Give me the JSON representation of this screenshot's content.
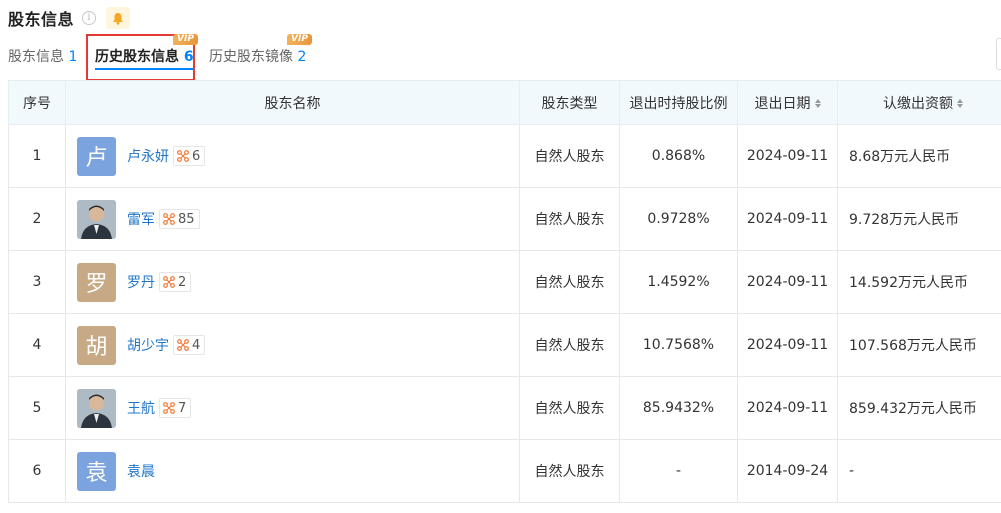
{
  "header": {
    "title": "股东信息",
    "info_icon": "info-icon",
    "bell_icon": "bell-icon",
    "bell_color": "#f5a623"
  },
  "tabs": [
    {
      "label": "股东信息",
      "count": "1",
      "active": false
    },
    {
      "label": "历史股东信息",
      "count": "6",
      "active": true,
      "vip": "VIP"
    },
    {
      "label": "历史股东镜像",
      "count": "2",
      "active": false,
      "vip": "VIP"
    }
  ],
  "table": {
    "columns": [
      "序号",
      "股东名称",
      "股东类型",
      "退出时持股比例",
      "退出日期",
      "认缴出资额"
    ],
    "rows": [
      {
        "index": "1",
        "avatar_char": "卢",
        "avatar_type": "blue",
        "name": "卢永妍",
        "rel_count": "6",
        "type": "自然人股东",
        "ratio": "0.868%",
        "date": "2024-09-11",
        "capital": "8.68万元人民币"
      },
      {
        "index": "2",
        "avatar_char": "",
        "avatar_type": "photo",
        "name": "雷军",
        "rel_count": "85",
        "type": "自然人股东",
        "ratio": "0.9728%",
        "date": "2024-09-11",
        "capital": "9.728万元人民币"
      },
      {
        "index": "3",
        "avatar_char": "罗",
        "avatar_type": "tan",
        "name": "罗丹",
        "rel_count": "2",
        "type": "自然人股东",
        "ratio": "1.4592%",
        "date": "2024-09-11",
        "capital": "14.592万元人民币"
      },
      {
        "index": "4",
        "avatar_char": "胡",
        "avatar_type": "tan",
        "name": "胡少宇",
        "rel_count": "4",
        "type": "自然人股东",
        "ratio": "10.7568%",
        "date": "2024-09-11",
        "capital": "107.568万元人民币"
      },
      {
        "index": "5",
        "avatar_char": "",
        "avatar_type": "photo",
        "name": "王航",
        "rel_count": "7",
        "type": "自然人股东",
        "ratio": "85.9432%",
        "date": "2024-09-11",
        "capital": "859.432万元人民币"
      },
      {
        "index": "6",
        "avatar_char": "袁",
        "avatar_type": "blue",
        "name": "袁晨",
        "rel_count": "",
        "type": "自然人股东",
        "ratio": "-",
        "date": "2014-09-24",
        "capital": "-"
      }
    ]
  },
  "colors": {
    "accent": "#0084ff",
    "link": "#1f76c9",
    "highlight": "#e53935",
    "header_bg": "#f2f9fc"
  }
}
